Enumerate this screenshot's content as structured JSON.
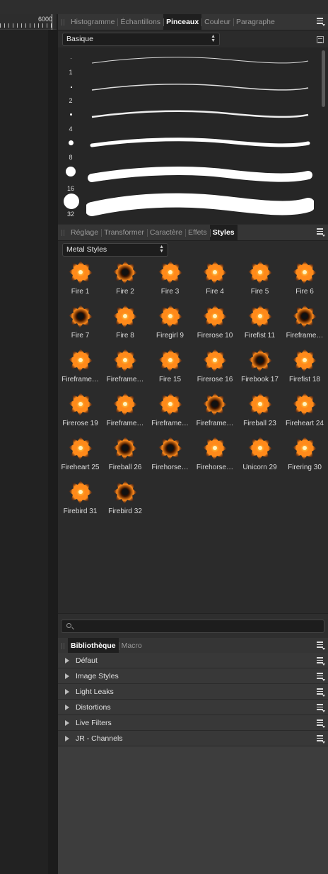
{
  "ruler": {
    "label": "6000"
  },
  "brushes_panel": {
    "tabs": [
      "Histogramme",
      "Échantillons",
      "Pinceaux",
      "Couleur",
      "Paragraphe"
    ],
    "active_tab": "Pinceaux",
    "category": "Basique",
    "sizes": [
      "1",
      "2",
      "4",
      "8",
      "16",
      "32"
    ]
  },
  "styles_panel": {
    "tabs": [
      "Réglage",
      "Transformer",
      "Caractère",
      "Effets",
      "Styles"
    ],
    "active_tab": "Styles",
    "category": "Metal Styles",
    "items": [
      "Fire 1",
      "Fire 2",
      "Fire 3",
      "Fire 4",
      "Fire 5",
      "Fire 6",
      "Fire 7",
      "Fire 8",
      "Firegirl 9",
      "Firerose 10",
      "Firefist 11",
      "Fireframe…",
      "Fireframe…",
      "Fireframe…",
      "Fire 15",
      "Firerose 16",
      "Firebook 17",
      "Firefist 18",
      "Firerose 19",
      "Fireframe…",
      "Fireframe…",
      "Fireframe…",
      "Fireball 23",
      "Fireheart 24",
      "Fireheart 25",
      "Fireball 26",
      "Firehorse…",
      "Firehorse…",
      "Unicorn 29",
      "Firering 30",
      "Firebird 31",
      "Firebird 32"
    ],
    "search_placeholder": ""
  },
  "library_panel": {
    "tabs": [
      "Bibliothèque",
      "Macro"
    ],
    "active_tab": "Bibliothèque",
    "items": [
      "Défaut",
      "Image Styles",
      "Light Leaks",
      "Distortions",
      "Live Filters",
      "JR - Channels"
    ]
  },
  "colors": {
    "panel_bg": "#2b2b2b",
    "tab_active_bg": "#1f1f1f",
    "fire_orange": "#ff8a1a",
    "fire_yellow": "#ffd24a"
  }
}
